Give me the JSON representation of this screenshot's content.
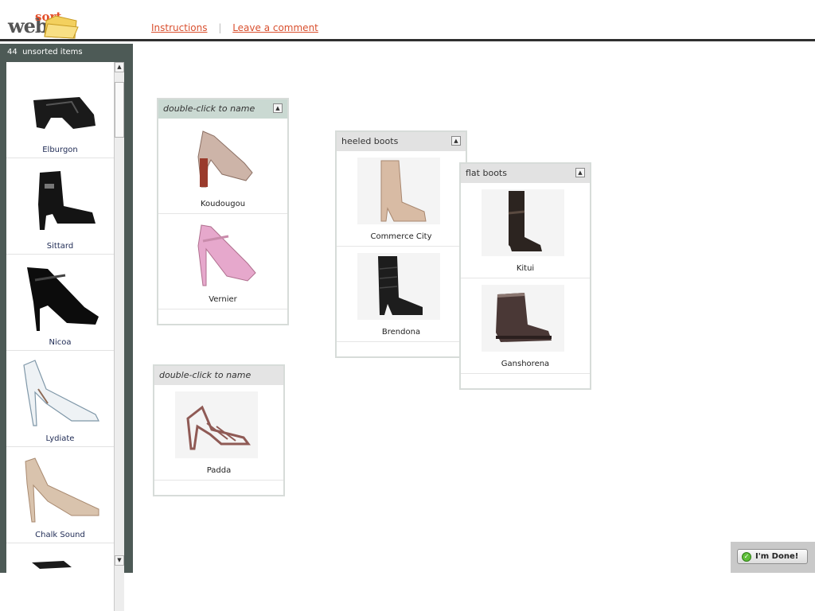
{
  "header": {
    "logo_web": "web",
    "logo_sort": "sort",
    "nav": [
      "Instructions",
      "Leave a comment"
    ],
    "nav_separator": "|"
  },
  "sidebar": {
    "count": "44",
    "count_label": "unsorted items",
    "items": [
      {
        "label": "Elburgon",
        "icon": "black-wedge-sandal"
      },
      {
        "label": "Sittard",
        "icon": "black-ankle-bootie"
      },
      {
        "label": "Nicoa",
        "icon": "black-patent-mary-jane"
      },
      {
        "label": "Lydiate",
        "icon": "white-stiletto-pump"
      },
      {
        "label": "Chalk Sound",
        "icon": "nude-pointed-pump"
      }
    ]
  },
  "groups": [
    {
      "title": "double-click to name",
      "style": "unnamed",
      "items": [
        {
          "label": "Koudougou",
          "icon": "tan-peep-toe-heel"
        },
        {
          "label": "Vernier",
          "icon": "pink-peep-toe-heel"
        }
      ]
    },
    {
      "title": "double-click to name",
      "style": "plain",
      "items": [
        {
          "label": "Padda",
          "icon": "strappy-sandal"
        }
      ]
    },
    {
      "title": "heeled boots",
      "style": "named",
      "items": [
        {
          "label": "Commerce City",
          "icon": "beige-tall-boot"
        },
        {
          "label": "Brendona",
          "icon": "black-slouch-boot"
        }
      ]
    },
    {
      "title": "flat boots",
      "style": "named",
      "items": [
        {
          "label": "Kitui",
          "icon": "brown-riding-boot"
        },
        {
          "label": "Ganshorena",
          "icon": "brown-ankle-boot"
        }
      ]
    }
  ],
  "done_button": {
    "label": "I'm Done!"
  },
  "colors": {
    "accent": "#d9502f",
    "sidebar": "#4d5a56",
    "header_rule": "#2f2f2f"
  }
}
